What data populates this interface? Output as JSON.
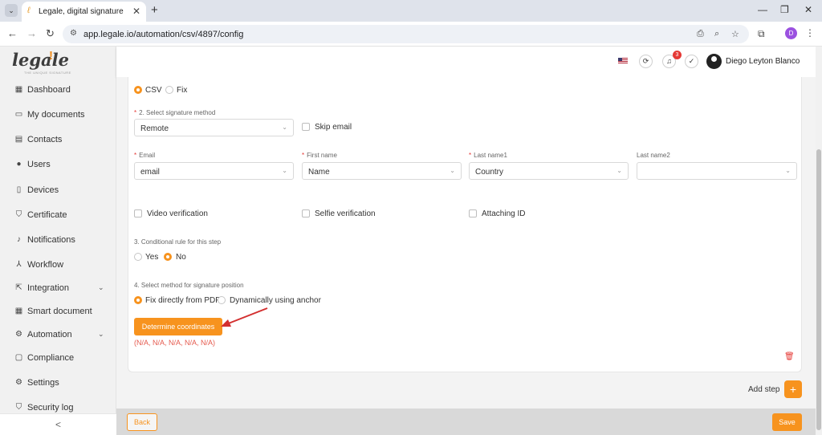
{
  "browser": {
    "tab_title": "Legale, digital signature",
    "url": "app.legale.io/automation/csv/4897/config",
    "profile_initial": "D"
  },
  "sidebar": {
    "logo": "legale",
    "logo_tagline": "THE UNIQUE SIGNATURE",
    "items": [
      {
        "label": "Dashboard",
        "icon": "dashboard-icon"
      },
      {
        "label": "My documents",
        "icon": "folder-icon"
      },
      {
        "label": "Contacts",
        "icon": "contacts-icon"
      },
      {
        "label": "Users",
        "icon": "user-icon"
      },
      {
        "label": "Devices",
        "icon": "device-icon"
      },
      {
        "label": "Certificate",
        "icon": "shield-check-icon"
      },
      {
        "label": "Notifications",
        "icon": "bell-icon"
      },
      {
        "label": "Workflow",
        "icon": "workflow-icon"
      },
      {
        "label": "Integration",
        "icon": "integration-icon"
      },
      {
        "label": "Smart document",
        "icon": "smart-document-icon"
      },
      {
        "label": "Automation",
        "icon": "automation-icon"
      },
      {
        "label": "Compliance",
        "icon": "compliance-icon"
      },
      {
        "label": "Settings",
        "icon": "gear-icon"
      },
      {
        "label": "Security log",
        "icon": "security-log-icon"
      }
    ],
    "collapse_glyph": "<"
  },
  "header": {
    "notification_count": "3",
    "user_name": "Diego Leyton Blanco"
  },
  "form": {
    "source": {
      "option_csv": "CSV",
      "option_fix": "Fix",
      "selected": "CSV"
    },
    "signature_method": {
      "label": "2. Select signature method",
      "value": "Remote",
      "skip_email_label": "Skip email"
    },
    "fields": [
      {
        "label": "Email",
        "required": true,
        "value": "email"
      },
      {
        "label": "First name",
        "required": true,
        "value": "Name"
      },
      {
        "label": "Last name1",
        "required": true,
        "value": "Country"
      },
      {
        "label": "Last name2",
        "required": false,
        "value": ""
      }
    ],
    "verifications": {
      "video": "Video verification",
      "selfie": "Selfie verification",
      "id": "Attaching ID"
    },
    "conditional": {
      "label": "3. Conditional rule for this step",
      "yes": "Yes",
      "no": "No",
      "selected": "No"
    },
    "position_method": {
      "label": "4. Select method for signature position",
      "fix": "Fix directly from PDF",
      "anchor": "Dynamically using anchor",
      "selected": "Fix directly from PDF"
    },
    "determine_button": "Determine coordinates",
    "coordinates": "(N/A, N/A, N/A, N/A, N/A)"
  },
  "actions": {
    "add_step": "Add step",
    "back": "Back",
    "save": "Save"
  },
  "colors": {
    "accent": "#f7931e",
    "error": "#e53935",
    "sidebar_bg": "#f1f1f1"
  }
}
